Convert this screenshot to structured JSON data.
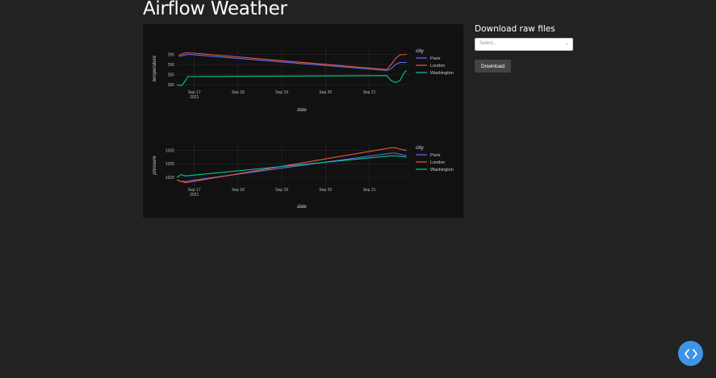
{
  "app": {
    "title": "Airflow Weather"
  },
  "sidebar": {
    "title": "Download raw files",
    "select_placeholder": "Select...",
    "download_label": "Download"
  },
  "colors": {
    "background": "#222222",
    "plot_bg": "#111111",
    "Paris": "#636efa",
    "London": "#ef553b",
    "Washington": "#00cc96",
    "fab": "#3e95e8"
  },
  "icons": {
    "fab": "code-icon",
    "select": "chevron-down-icon"
  },
  "chart_data": [
    {
      "type": "line",
      "ylabel": "temperature",
      "xlabel": "date",
      "x_ticks": [
        "Sep 17",
        "Sep 18",
        "Sep 19",
        "Sep 20",
        "Sep 21"
      ],
      "x_tick_sub": "2021",
      "x_range": [
        16.6,
        21.95
      ],
      "y_ticks": [
        280,
        285,
        290,
        295
      ],
      "y_range": [
        278,
        298
      ],
      "grid": true,
      "legend_title": "city",
      "legend_placement": "right",
      "series": [
        {
          "name": "Paris",
          "points": [
            [
              16.65,
              294
            ],
            [
              16.75,
              294.5
            ],
            [
              16.85,
              295
            ],
            [
              17,
              294.8
            ],
            [
              21.4,
              287
            ],
            [
              21.5,
              288
            ],
            [
              21.6,
              290
            ],
            [
              21.7,
              291
            ],
            [
              21.85,
              291
            ]
          ]
        },
        {
          "name": "London",
          "points": [
            [
              16.65,
              294.5
            ],
            [
              16.75,
              295.5
            ],
            [
              16.85,
              295.8
            ],
            [
              17,
              295.6
            ],
            [
              21.4,
              287.5
            ],
            [
              21.5,
              290
            ],
            [
              21.6,
              293
            ],
            [
              21.7,
              294.8
            ],
            [
              21.85,
              295
            ]
          ]
        },
        {
          "name": "Washington",
          "points": [
            [
              16.6,
              280
            ],
            [
              16.7,
              279.5
            ],
            [
              16.75,
              280.5
            ],
            [
              16.8,
              282
            ],
            [
              16.85,
              284
            ],
            [
              21.4,
              284.5
            ],
            [
              21.5,
              282
            ],
            [
              21.6,
              281
            ],
            [
              21.7,
              282
            ],
            [
              21.8,
              286
            ],
            [
              21.85,
              287
            ]
          ]
        }
      ]
    },
    {
      "type": "line",
      "ylabel": "pressure",
      "xlabel": "date",
      "x_ticks": [
        "Sep 17",
        "Sep 18",
        "Sep 19",
        "Sep 20",
        "Sep 21"
      ],
      "x_tick_sub": "2021",
      "x_range": [
        16.6,
        21.95
      ],
      "y_ticks": [
        1020,
        1025,
        1030
      ],
      "y_tick_labels": [
        "1020",
        "1025",
        "1030"
      ],
      "y_range": [
        1017,
        1032
      ],
      "grid": true,
      "legend_title": "city",
      "legend_placement": "right",
      "series": [
        {
          "name": "Paris",
          "points": [
            [
              16.65,
              1018.5
            ],
            [
              16.8,
              1018.5
            ],
            [
              21.5,
              1029
            ],
            [
              21.6,
              1029
            ],
            [
              21.85,
              1028
            ]
          ]
        },
        {
          "name": "London",
          "points": [
            [
              16.6,
              1019
            ],
            [
              16.8,
              1018
            ],
            [
              21.5,
              1031
            ],
            [
              21.6,
              1031
            ],
            [
              21.7,
              1030.5
            ],
            [
              21.85,
              1030
            ]
          ]
        },
        {
          "name": "Washington",
          "points": [
            [
              16.6,
              1020
            ],
            [
              16.7,
              1021
            ],
            [
              16.8,
              1020.5
            ],
            [
              21.5,
              1028
            ],
            [
              21.6,
              1028
            ],
            [
              21.85,
              1027.5
            ]
          ]
        }
      ]
    }
  ]
}
